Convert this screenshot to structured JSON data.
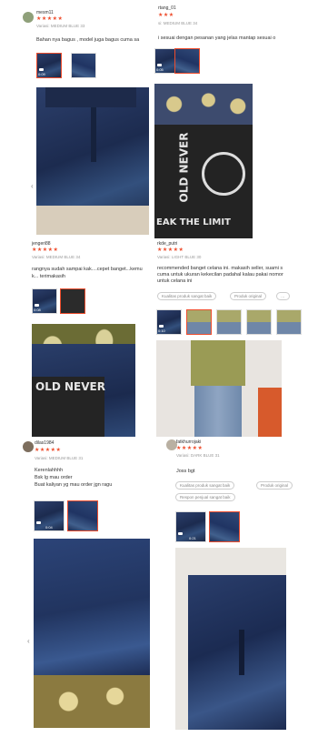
{
  "reviews": [
    {
      "username": "mesm11",
      "stars": "★★★★★",
      "variant": "Variasi: MEDIUM BLUE 33",
      "text": "Bahan nya bagus , model juga bagus cuma sa",
      "thumbs": [
        {
          "duration": "0:09"
        },
        {
          "duration": ""
        }
      ]
    },
    {
      "username": "rtang_01",
      "stars": "★★★",
      "variant": "si: MEDIUM BLUE 34",
      "text": "i sesuai dengan pesanan yang jelas mantap sesuai o",
      "thumbs": [
        {
          "duration": "0:05"
        },
        {
          "duration": ""
        }
      ],
      "shirt_text_1": "OLD NEVER",
      "shirt_text_2": "EAK THE LIMIT"
    },
    {
      "username": "jengeri88",
      "stars": "★★★★★",
      "variant": "Variasi: MEDIUM BLUE 34",
      "text_lines": [
        "rangnya sudah sampai kak....cepet banget...kemu",
        "k... terimakasih"
      ],
      "thumbs": [
        {
          "duration": "0:08"
        },
        {
          "duration": ""
        }
      ],
      "shirt_text": "OLD NEVER"
    },
    {
      "username": "rkde_putri",
      "stars": "★★★★★",
      "variant": "Variasi: LIGHT BLUE 30",
      "text_lines": [
        "recommended banget celana ini. makasih seller, suami s",
        "cuma untuk ukuran kekecilan padahal kalau pakai nomor",
        "untuk celana ini"
      ],
      "chips": [
        "Kualitas produk sangat baik",
        "Produk original",
        "…"
      ],
      "thumbs": [
        {
          "duration": "0:10"
        },
        {
          "duration": ""
        },
        {
          "duration": ""
        },
        {
          "duration": ""
        },
        {
          "duration": ""
        }
      ]
    },
    {
      "username": "dilas1984",
      "stars": "★★★★★",
      "variant": "Variasi: MEDIUM BLUE 31",
      "text_lines": [
        "Kerenlahhhh",
        "Bsk lg mau order",
        "Buat kaliyan yg mau order jgn ragu"
      ],
      "thumbs": [
        {
          "duration": "0:04"
        },
        {
          "duration": ""
        }
      ]
    },
    {
      "username": "fatkhurrojaki",
      "stars": "★★★★★",
      "variant": "Variasi: DARK BLUE 31",
      "text": "Joss bgt",
      "chips": [
        "Kualitas produk sangat baik",
        "Produk original",
        "Respon penjual sangat baik"
      ],
      "thumbs": [
        {
          "duration": "0:21"
        },
        {
          "duration": ""
        }
      ]
    }
  ],
  "nav": {
    "prev_arrow": "‹"
  }
}
